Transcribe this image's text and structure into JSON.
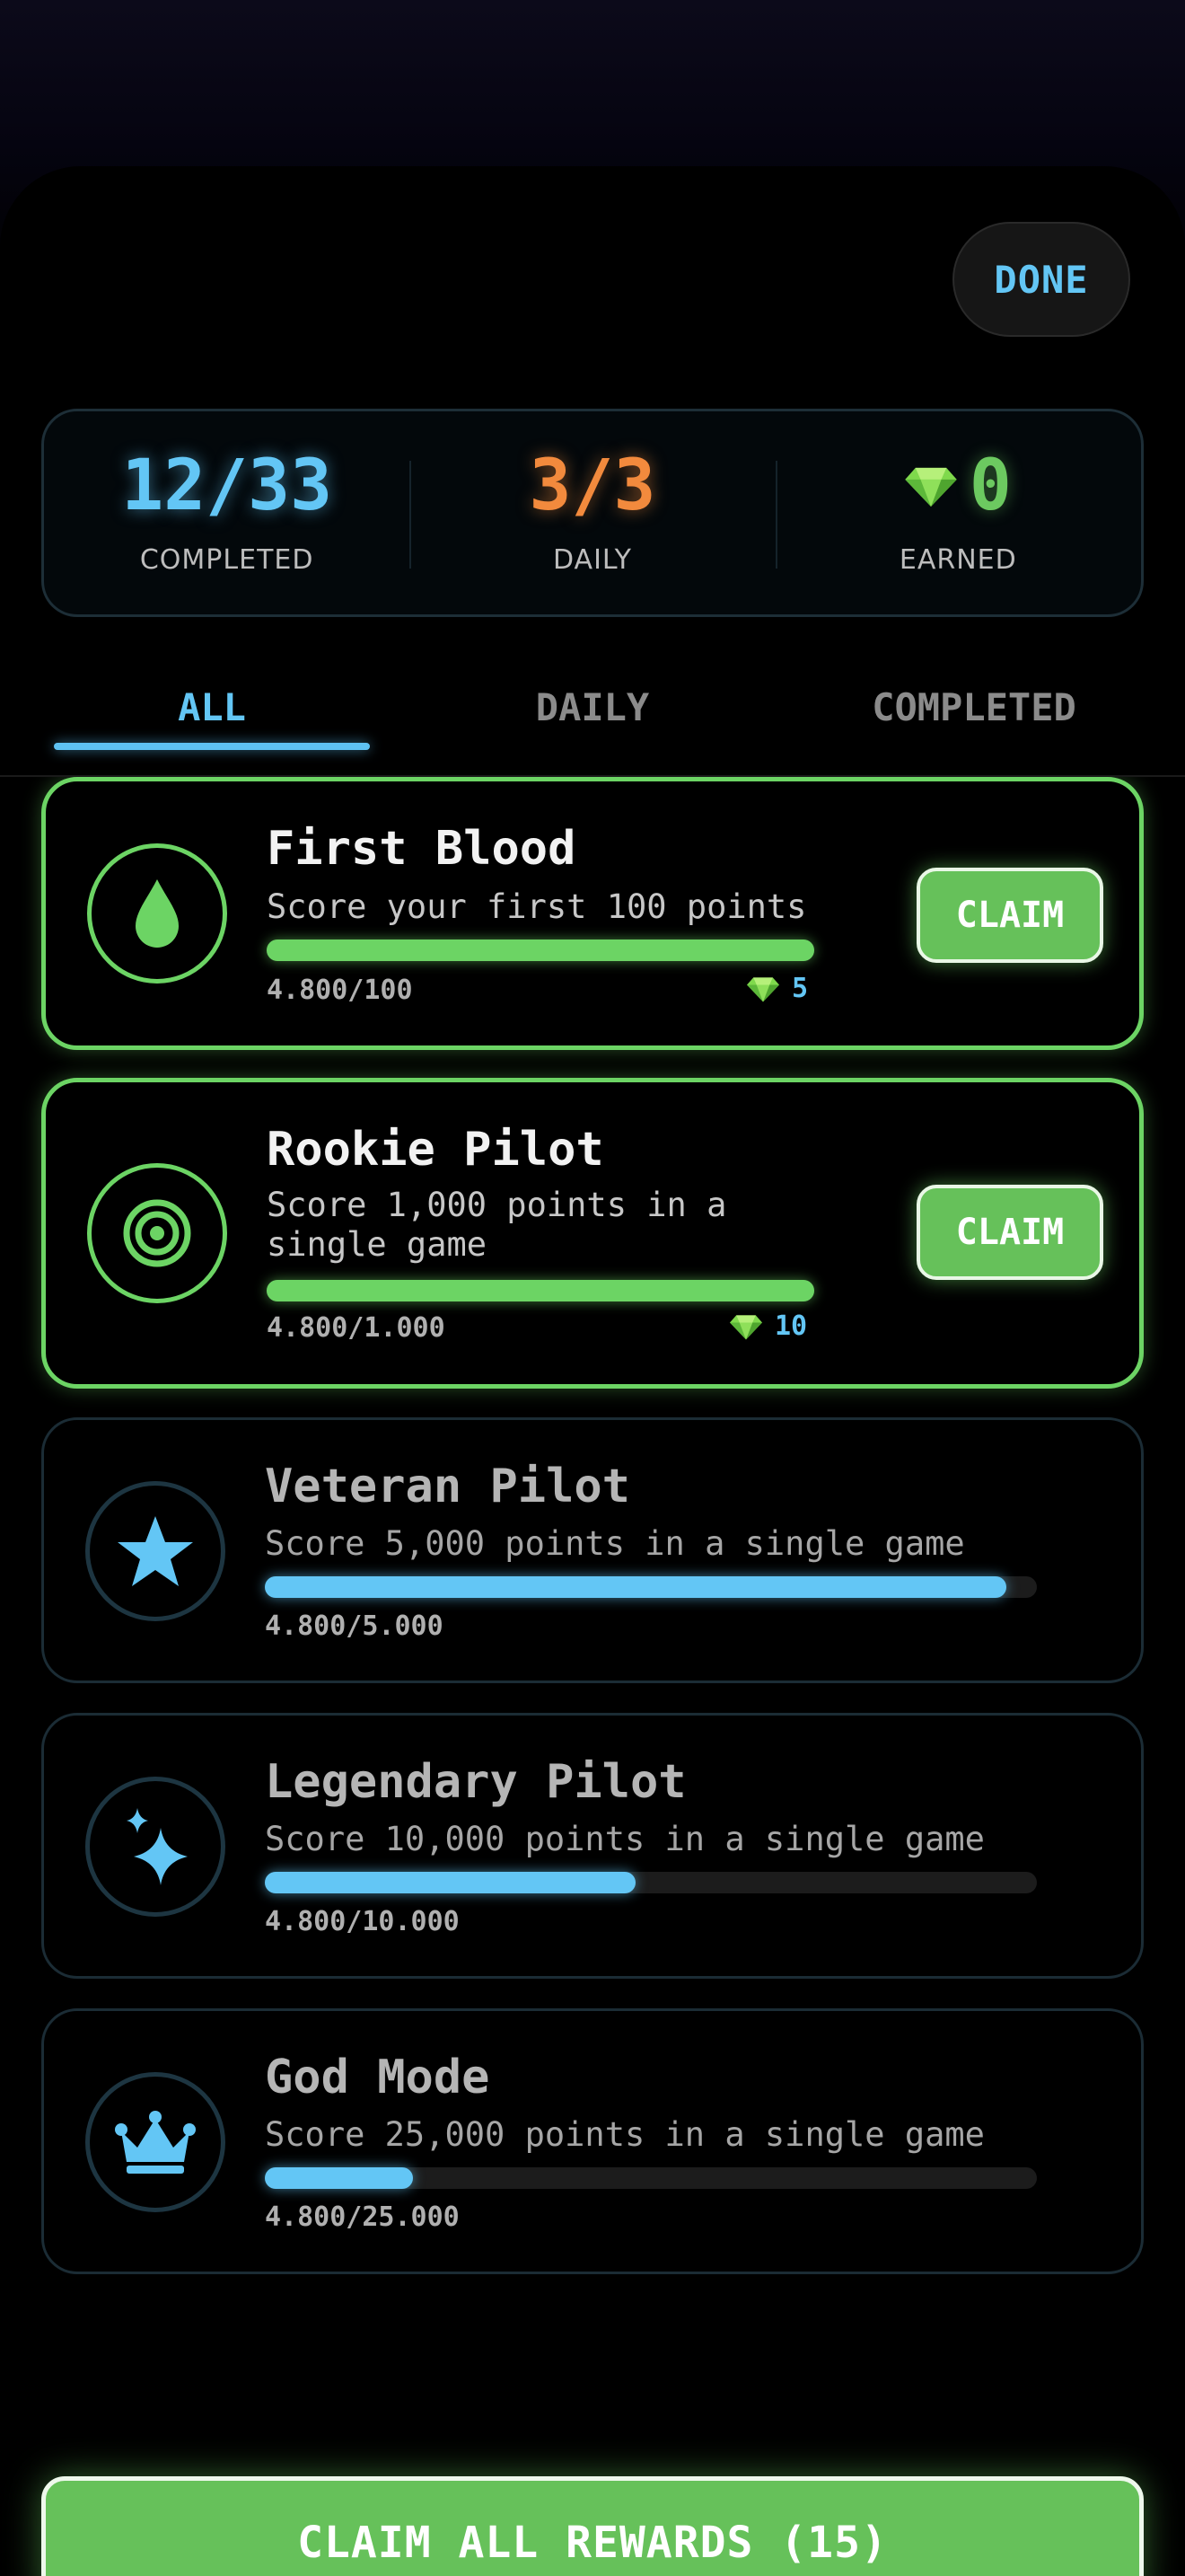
{
  "header": {
    "done_label": "DONE"
  },
  "stats": {
    "completed": {
      "value": "12/33",
      "label": "COMPLETED"
    },
    "daily": {
      "value": "3/3",
      "label": "DAILY"
    },
    "earned": {
      "value": "0",
      "label": "EARNED",
      "icon": "gem-icon"
    }
  },
  "tabs": [
    {
      "label": "ALL",
      "active": true
    },
    {
      "label": "DAILY",
      "active": false
    },
    {
      "label": "COMPLETED",
      "active": false
    }
  ],
  "achievements": [
    {
      "title": "First Blood",
      "description": "Score your first 100 points",
      "progress": "4.800/100",
      "progress_fraction": 1.0,
      "reward": "5",
      "status": "claimable",
      "icon": "droplet-icon",
      "claim_label": "CLAIM"
    },
    {
      "title": "Rookie Pilot",
      "description": "Score 1,000 points in a single game",
      "progress": "4.800/1.000",
      "progress_fraction": 1.0,
      "reward": "10",
      "status": "claimable",
      "icon": "target-icon",
      "claim_label": "CLAIM"
    },
    {
      "title": "Veteran Pilot",
      "description": "Score 5,000 points in a single game",
      "progress": "4.800/5.000",
      "progress_fraction": 0.96,
      "status": "in-progress",
      "icon": "star-icon"
    },
    {
      "title": "Legendary Pilot",
      "description": "Score 10,000 points in a single game",
      "progress": "4.800/10.000",
      "progress_fraction": 0.48,
      "status": "in-progress",
      "icon": "sparkles-icon"
    },
    {
      "title": "God Mode",
      "description": "Score 25,000 points in a single game",
      "progress": "4.800/25.000",
      "progress_fraction": 0.192,
      "status": "in-progress",
      "icon": "crown-icon"
    }
  ],
  "footer": {
    "claim_all_label": "CLAIM ALL REWARDS (15)"
  },
  "colors": {
    "accent_blue": "#63c6f5",
    "accent_green": "#6cd464",
    "accent_orange": "#f28a3d",
    "background": "#000000"
  }
}
